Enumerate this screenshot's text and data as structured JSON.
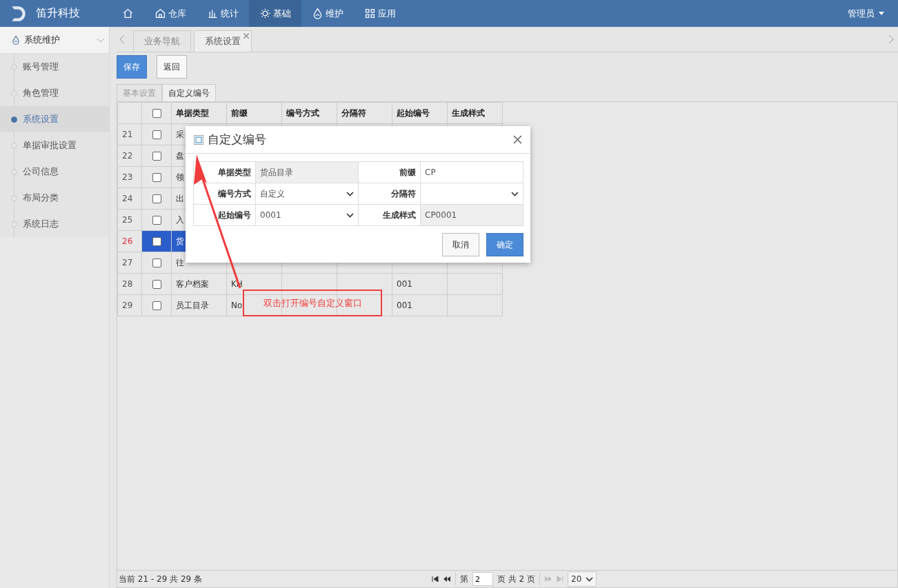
{
  "brand": {
    "name": "笛升科技"
  },
  "nav": [
    {
      "kind": "home",
      "selected": false
    },
    {
      "kind": "warehouse",
      "label": "仓库",
      "selected": false
    },
    {
      "kind": "stats",
      "label": "统计",
      "selected": false
    },
    {
      "kind": "gear",
      "label": "基础",
      "selected": true
    },
    {
      "kind": "drop",
      "label": "维护",
      "selected": false
    },
    {
      "kind": "apps",
      "label": "应用",
      "selected": false
    }
  ],
  "user": {
    "name": "管理员"
  },
  "sidebar": {
    "title": "系统维护",
    "items": [
      {
        "label": "账号管理",
        "selected": false
      },
      {
        "label": "角色管理",
        "selected": false
      },
      {
        "label": "系统设置",
        "selected": true
      },
      {
        "label": "单据审批设置",
        "selected": false
      },
      {
        "label": "公司信息",
        "selected": false
      },
      {
        "label": "布局分类",
        "selected": false
      },
      {
        "label": "系统日志",
        "selected": false
      }
    ]
  },
  "page_tabs": [
    {
      "label": "业务导航",
      "selected": false,
      "closable": false
    },
    {
      "label": "系统设置",
      "selected": true,
      "closable": true
    }
  ],
  "toolbar": [
    {
      "label": "保存",
      "kind": "primary"
    },
    {
      "label": "返回",
      "kind": "default"
    }
  ],
  "settings_tabs": [
    {
      "label": "基本设置",
      "selected": false
    },
    {
      "label": "自定义编号",
      "selected": true
    }
  ],
  "table": {
    "all_checked": false,
    "columns": [
      "单据类型",
      "前缀",
      "编号方式",
      "分隔符",
      "起始编号",
      "生成样式"
    ],
    "rows": [
      {
        "index": "21",
        "selected": false,
        "checked": false,
        "cells": [
          "采",
          null,
          null,
          null,
          null,
          null
        ]
      },
      {
        "index": "22",
        "selected": false,
        "checked": false,
        "cells": [
          "盘",
          null,
          null,
          null,
          null,
          null
        ]
      },
      {
        "index": "23",
        "selected": false,
        "checked": false,
        "cells": [
          "领",
          null,
          null,
          null,
          null,
          null
        ]
      },
      {
        "index": "24",
        "selected": false,
        "checked": false,
        "cells": [
          "出",
          null,
          null,
          null,
          null,
          null
        ]
      },
      {
        "index": "25",
        "selected": false,
        "checked": false,
        "cells": [
          "入",
          null,
          null,
          null,
          null,
          null
        ]
      },
      {
        "index": "26",
        "selected": true,
        "checked": false,
        "cells": [
          "货",
          null,
          null,
          null,
          null,
          null
        ]
      },
      {
        "index": "27",
        "selected": false,
        "checked": false,
        "cells": [
          "往",
          null,
          null,
          null,
          null,
          null
        ]
      },
      {
        "index": "28",
        "selected": false,
        "checked": false,
        "cells": [
          "客户档案",
          "KH",
          null,
          null,
          "001",
          null
        ]
      },
      {
        "index": "29",
        "selected": false,
        "checked": false,
        "cells": [
          "员工目录",
          "No",
          null,
          null,
          "001",
          null
        ]
      }
    ]
  },
  "pager": {
    "summary": "当前 21 - 29 共 29 条",
    "page_prefix": "第",
    "page": "2",
    "page_suffix": "页 共 2 页",
    "page_size": "20"
  },
  "dialog": {
    "title": "自定义编号",
    "fields": [
      {
        "label": "单据类型",
        "value": "货品目录",
        "kind": "readonly"
      },
      {
        "label": "前缀",
        "value": "CP",
        "kind": "text"
      },
      {
        "label": "编号方式",
        "value": "自定义",
        "kind": "select"
      },
      {
        "label": "分隔符",
        "kind": "select"
      },
      {
        "label": "起始编号",
        "value": "0001",
        "kind": "select"
      },
      {
        "label": "生成样式",
        "value": "CP0001",
        "kind": "readonly"
      }
    ],
    "buttons": [
      {
        "label": "取消",
        "kind": "default"
      },
      {
        "label": "确定",
        "kind": "primary"
      }
    ]
  },
  "annotation": {
    "text": "双击打开编号自定义窗口"
  }
}
